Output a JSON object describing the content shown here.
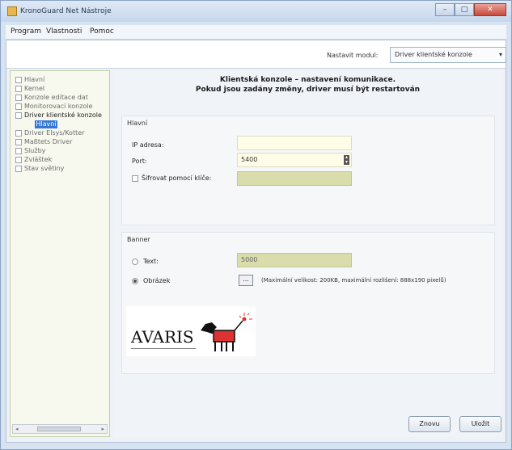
{
  "window": {
    "title": "KronoGuard Net Nástroje",
    "minimize_glyph": "–",
    "maximize_glyph": "□",
    "close_glyph": "✕"
  },
  "menu": [
    "Program",
    "Vlastnosti",
    "Pomoc"
  ],
  "module": {
    "label": "Nastavit modul:",
    "selected": "Driver klientské konzole",
    "arrow": "▾"
  },
  "sidebar": {
    "items": [
      {
        "label": "Hlavní"
      },
      {
        "label": "Kernel"
      },
      {
        "label": "Konzole editace dat"
      },
      {
        "label": "Monitorovací konzole"
      },
      {
        "label": "Driver klientské konzole"
      },
      {
        "label": "Driver Elsys/Kotter"
      },
      {
        "label": "Maßtets Driver"
      },
      {
        "label": "Služby"
      },
      {
        "label": "Zvláštek"
      },
      {
        "label": "Stav světiny"
      }
    ],
    "selected_child": "Hlavní",
    "scroll_left": "◂",
    "scroll_right": "▸"
  },
  "main": {
    "heading_line1": "Klientská konzole – nastavení komunikace.",
    "heading_line2": "Pokud jsou zadány změny, driver musí být restartován"
  },
  "hlavni": {
    "title": "Hlavní",
    "ip_label": "IP adresa:",
    "ip_value": "",
    "port_label": "Port:",
    "port_value": "5400",
    "encrypt_label": "Šifrovat pomocí klíče:",
    "encrypt_value": ""
  },
  "banner": {
    "title": "Banner",
    "text_label": "Text:",
    "text_value": "5000",
    "image_label": "Obrázek",
    "browse_label": "...",
    "hint": "(Maximální velikost: 200KB, maximální rozlišení: 888x190 pixelů)",
    "logo_text": "AVARIS"
  },
  "buttons": {
    "renew": "Znovu",
    "save": "Uložit"
  }
}
